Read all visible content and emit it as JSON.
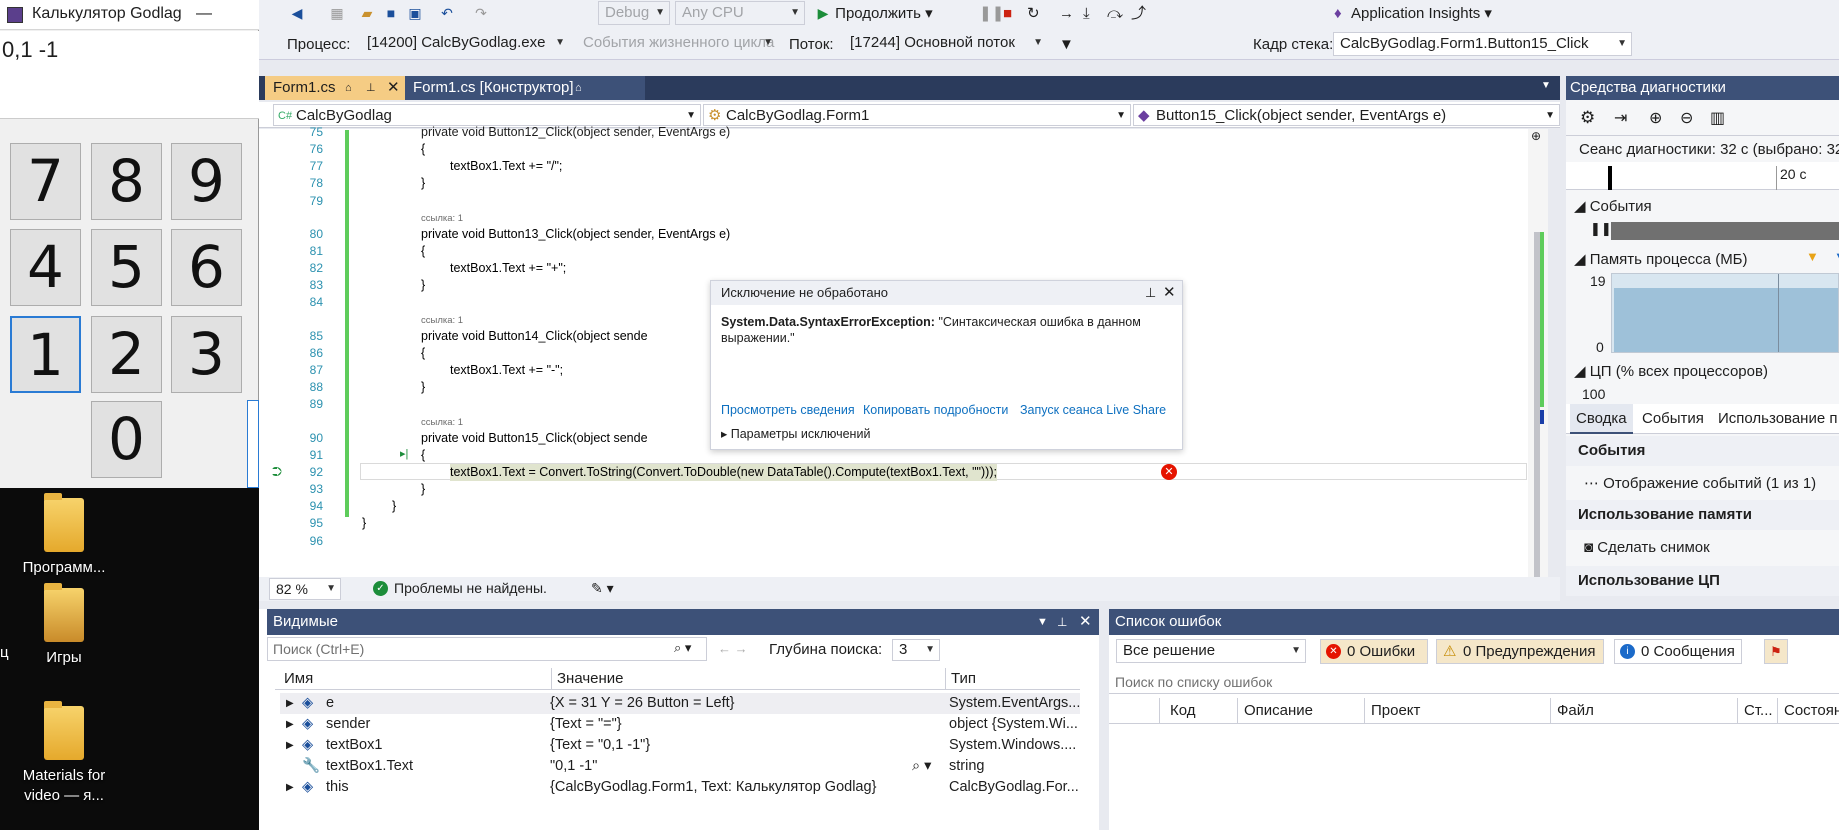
{
  "calculator": {
    "title": "Калькулятор Godlag",
    "minimize": "—",
    "display": "0,1 -1",
    "keys": [
      "7",
      "8",
      "9",
      "4",
      "5",
      "6",
      "1",
      "2",
      "3",
      "0"
    ]
  },
  "desktop": {
    "icons": [
      {
        "label": "Программ..."
      },
      {
        "label": "Игры"
      },
      {
        "label": "Materials for video — я..."
      }
    ],
    "edge_text": "ц"
  },
  "toolbar": {
    "config": "Debug",
    "platform": "Any CPU",
    "continue_label": "Продолжить",
    "insights_label": "Application Insights"
  },
  "debugbar": {
    "process_label": "Процесс:",
    "process_value": "[14200] CalcByGodlag.exe",
    "lifecycle_label": "События жизненного цикла",
    "thread_label": "Поток:",
    "thread_value": "[17244] Основной поток",
    "stack_label": "Кадр стека:",
    "stack_value": "CalcByGodlag.Form1.Button15_Click"
  },
  "tabs": [
    {
      "label": "Form1.cs"
    },
    {
      "label": "Form1.cs [Конструктор]"
    }
  ],
  "navbar": {
    "project": "CalcByGodlag",
    "class": "CalcByGodlag.Form1",
    "member": "Button15_Click(object sender, EventArgs e)"
  },
  "editor": {
    "ref_label": "ссылка: 1",
    "lines": [
      {
        "n": "75",
        "code": "private void Button12_Click(object sender, EventArgs e)"
      },
      {
        "n": "76",
        "code": "{"
      },
      {
        "n": "77",
        "code": "textBox1.Text += \"/\";"
      },
      {
        "n": "78",
        "code": "}"
      },
      {
        "n": "79",
        "code": ""
      },
      {
        "n": "80",
        "code": "private void Button13_Click(object sender, EventArgs e)"
      },
      {
        "n": "81",
        "code": "{"
      },
      {
        "n": "82",
        "code": "textBox1.Text += \"+\";"
      },
      {
        "n": "83",
        "code": "}"
      },
      {
        "n": "84",
        "code": ""
      },
      {
        "n": "85",
        "code": "private void Button14_Click(object sende"
      },
      {
        "n": "86",
        "code": "{"
      },
      {
        "n": "87",
        "code": "textBox1.Text += \"-\";"
      },
      {
        "n": "88",
        "code": "}"
      },
      {
        "n": "89",
        "code": ""
      },
      {
        "n": "90",
        "code": "private void Button15_Click(object sende"
      },
      {
        "n": "91",
        "code": "{"
      },
      {
        "n": "92",
        "code": "textBox1.Text = Convert.ToString(Convert.ToDouble(new DataTable().Compute(textBox1.Text, \"\")));"
      },
      {
        "n": "93",
        "code": "}"
      },
      {
        "n": "94",
        "code": "}"
      },
      {
        "n": "95",
        "code": "}"
      },
      {
        "n": "96",
        "code": ""
      }
    ],
    "zoom": "82 %",
    "status": "Проблемы не найдены."
  },
  "exception": {
    "title": "Исключение не обработано",
    "type": "System.Data.SyntaxErrorException:",
    "message": "\"Синтаксическая ошибка в данном выражении.\"",
    "link1": "Просмотреть сведения",
    "link2": "Копировать подробности",
    "link3": "Запуск сеанса Live Share",
    "settings": "Параметры исключений"
  },
  "watch": {
    "title": "Видимые",
    "search_placeholder": "Поиск (Ctrl+E)",
    "depth_label": "Глубина поиска:",
    "depth_value": "3",
    "col_name": "Имя",
    "col_value": "Значение",
    "col_type": "Тип",
    "rows": [
      {
        "name": "e",
        "value": "{X = 31 Y = 26 Button = Left}",
        "type": "System.EventArgs..."
      },
      {
        "name": "sender",
        "value": "{Text = \"=\"}",
        "type": "object {System.Wi..."
      },
      {
        "name": "textBox1",
        "value": "{Text = \"0,1 -1\"}",
        "type": "System.Windows...."
      },
      {
        "name": "textBox1.Text",
        "value": "\"0,1 -1\"",
        "type": "string"
      },
      {
        "name": "this",
        "value": "{CalcByGodlag.Form1, Text: Калькулятор Godlag}",
        "type": "CalcByGodlag.For..."
      }
    ]
  },
  "errors": {
    "title": "Список ошибок",
    "scope": "Все решение",
    "errors_btn": "0 Ошибки",
    "warnings_btn": "0 Предупреждения",
    "messages_btn": "0 Сообщения",
    "search_placeholder": "Поиск по списку ошибок",
    "cols": [
      "Код",
      "Описание",
      "Проект",
      "Файл",
      "Ст...",
      "Состоян"
    ]
  },
  "diagnostics": {
    "title": "Средства диагностики",
    "session": "Сеанс диагностики: 32 с (выбрано: 32",
    "tick": "20 с",
    "events_label": "События",
    "memory_label": "Память процесса (МБ)",
    "mem_max": "19",
    "mem_min": "0",
    "cpu_label": "ЦП (% всех процессоров)",
    "cpu_max": "100",
    "tabs": [
      "Сводка",
      "События",
      "Использование п"
    ],
    "sec_events": "События",
    "events_item": "Отображение событий (1 из 1)",
    "sec_memory": "Использование памяти",
    "snapshot": "Сделать снимок",
    "sec_cpu": "Использование ЦП"
  },
  "colors": {
    "accent_tab": "#f5cc84",
    "panel_header": "#3d5178",
    "link": "#0e70c0",
    "error": "#e51400"
  }
}
